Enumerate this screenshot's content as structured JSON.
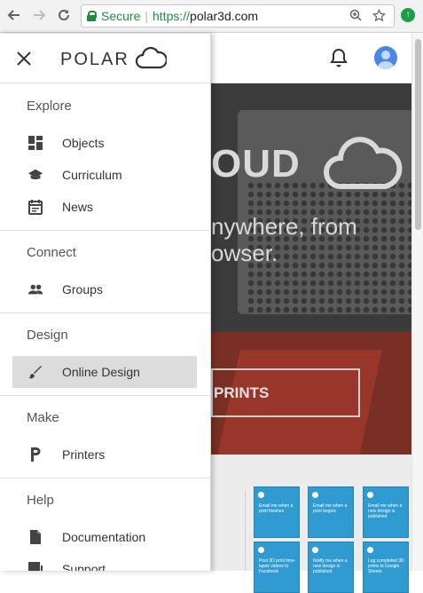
{
  "browser": {
    "secure_label": "Secure",
    "url_scheme": "https://",
    "url_host": "polar3d.com",
    "icons": [
      "back-icon",
      "forward-icon",
      "reload-icon",
      "lock-icon",
      "zoom-icon",
      "star-icon",
      "update-icon"
    ]
  },
  "header": {
    "logo_text": "POLAR",
    "icons": [
      "close-icon",
      "cloud-logo-icon",
      "bell-icon",
      "avatar-icon"
    ]
  },
  "hero": {
    "title_fragment": "OUD",
    "subtitle_line1": "nywhere, from",
    "subtitle_line2": "owser.",
    "button_fragment": "PRINTS"
  },
  "cards": [
    {
      "text": "Email me when a print finishes"
    },
    {
      "text": "Email me when a print begins"
    },
    {
      "text": "Email me when a new design is published"
    },
    {
      "text": "Post 3D print time-lapse videos to Facebook"
    },
    {
      "text": "Notify me when a new design is published"
    },
    {
      "text": "Log completed 3D prints to Google Sheets"
    }
  ],
  "drawer": {
    "sections": [
      {
        "title": "Explore",
        "items": [
          {
            "label": "Objects",
            "icon": "dashboard-icon"
          },
          {
            "label": "Curriculum",
            "icon": "school-icon"
          },
          {
            "label": "News",
            "icon": "calendar-icon"
          }
        ]
      },
      {
        "title": "Connect",
        "items": [
          {
            "label": "Groups",
            "icon": "people-icon"
          }
        ]
      },
      {
        "title": "Design",
        "items": [
          {
            "label": "Online Design",
            "icon": "brush-icon",
            "active": true
          }
        ]
      },
      {
        "title": "Make",
        "items": [
          {
            "label": "Printers",
            "icon": "p-icon"
          }
        ]
      },
      {
        "title": "Help",
        "items": [
          {
            "label": "Documentation",
            "icon": "document-icon"
          },
          {
            "label": "Support",
            "icon": "chat-icon"
          }
        ]
      }
    ]
  },
  "colors": {
    "secure_green": "#1e8e3e",
    "active_item_bg": "#dcdcdc",
    "card_blue": "#2f9bd0"
  }
}
